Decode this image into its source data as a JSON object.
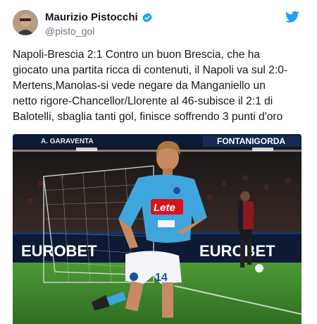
{
  "tweet": {
    "author_name": "Maurizio Pistocchi",
    "handle": "@pisto_gol",
    "text": "Napoli-Brescia 2:1 Contro un buon Brescia, che ha\ngiocato una partita ricca di contenuti, il Napoli va sul 2:0-\nMertens,Manolas-si vede negare da Manganiello un\nnetto rigore-Chancellor/Llorente al 46-subisce il 2:1 di\nBalotelli, sbaglia tanti gol, finisce soffrendo 3 punti d'oro"
  },
  "photo": {
    "board_top_left": "A. GARAVENTA",
    "board_top_right": "FONTANIGORDA",
    "board_left": "EUROBET",
    "board_right": "EUROBET",
    "jersey_sponsor": "Lete",
    "jersey_number": "14"
  },
  "icons": {
    "verified": "verified-badge-icon",
    "platform": "twitter-bird-icon"
  },
  "colors": {
    "verified_blue": "#1da1f2",
    "name_text": "#14171a",
    "handle_text": "#657786",
    "napoli_sky_blue": "#3fa6dd",
    "pitch_green": "#3f8a2d"
  }
}
